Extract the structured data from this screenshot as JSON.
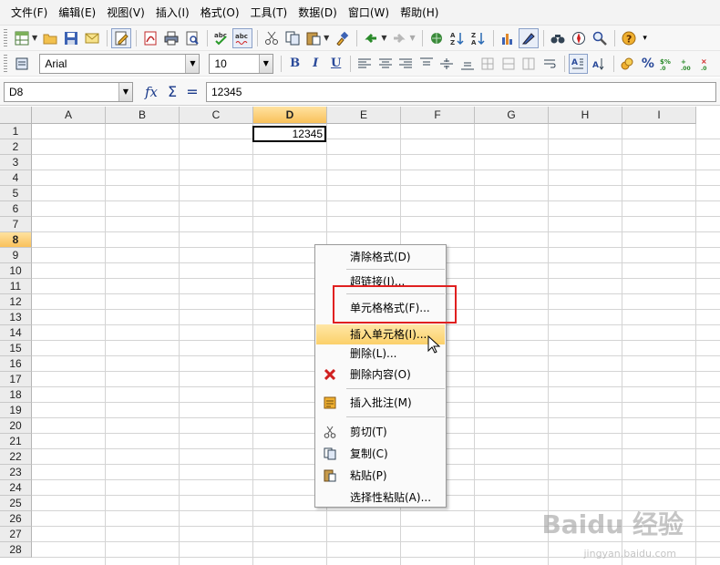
{
  "menu": [
    "文件(F)",
    "编辑(E)",
    "视图(V)",
    "插入(I)",
    "格式(O)",
    "工具(T)",
    "数据(D)",
    "窗口(W)",
    "帮助(H)"
  ],
  "toolbar1": {
    "icons": [
      "new-spreadsheet-icon",
      "open-folder-icon",
      "save-icon",
      "email-icon",
      "edit-file-icon",
      "export-pdf-icon",
      "print-icon",
      "print-preview-icon",
      "spellcheck-icon",
      "autospellcheck-icon",
      "cut-icon",
      "copy-icon",
      "paste-icon",
      "format-paintbrush-icon",
      "undo-icon",
      "redo-icon",
      "hyperlink-icon",
      "sort-ascending-icon",
      "sort-descending-icon",
      "chart-icon",
      "draw-icon",
      "find-icon",
      "navigator-icon",
      "zoom-icon",
      "help-icon"
    ]
  },
  "font": {
    "name": "Arial",
    "size": "10"
  },
  "formula_bar": {
    "cell_ref": "D8",
    "fx": "fx",
    "sum": "Σ",
    "eq": "=",
    "content": "12345"
  },
  "columns": [
    "A",
    "B",
    "C",
    "D",
    "E",
    "F",
    "G",
    "H",
    "I"
  ],
  "selected_column": "D",
  "rows": [
    "1",
    "2",
    "3",
    "4",
    "5",
    "6",
    "7",
    "8",
    "9",
    "10",
    "11",
    "12",
    "13",
    "14",
    "15",
    "16",
    "17",
    "18",
    "19",
    "20",
    "21",
    "22",
    "23",
    "24",
    "25",
    "26",
    "27",
    "28"
  ],
  "selected_row": "8",
  "active_cell": {
    "ref": "D8",
    "value": "12345"
  },
  "context_menu": [
    {
      "label": "清除格式(D)",
      "icon": ""
    },
    {
      "label": "超链接(I)...",
      "icon": ""
    },
    {
      "label": "单元格格式(F)...",
      "icon": ""
    },
    {
      "label": "插入单元格(I)...",
      "icon": "",
      "highlighted": true
    },
    {
      "label": "删除(L)...",
      "icon": ""
    },
    {
      "label": "删除内容(O)",
      "icon": "delete-x-icon"
    },
    {
      "label": "插入批注(M)",
      "icon": "comment-icon"
    },
    {
      "label": "剪切(T)",
      "icon": "cut-icon"
    },
    {
      "label": "复制(C)",
      "icon": "copy-icon"
    },
    {
      "label": "粘贴(P)",
      "icon": "paste-icon"
    },
    {
      "label": "选择性粘贴(A)...",
      "icon": ""
    }
  ],
  "colors": {
    "highlight": "#fbd06a",
    "selected_header": "#f9c15b",
    "annotation_red": "#e02020"
  },
  "watermark": {
    "main": "Baidu 经验",
    "sub": "jingyan.baidu.com"
  }
}
